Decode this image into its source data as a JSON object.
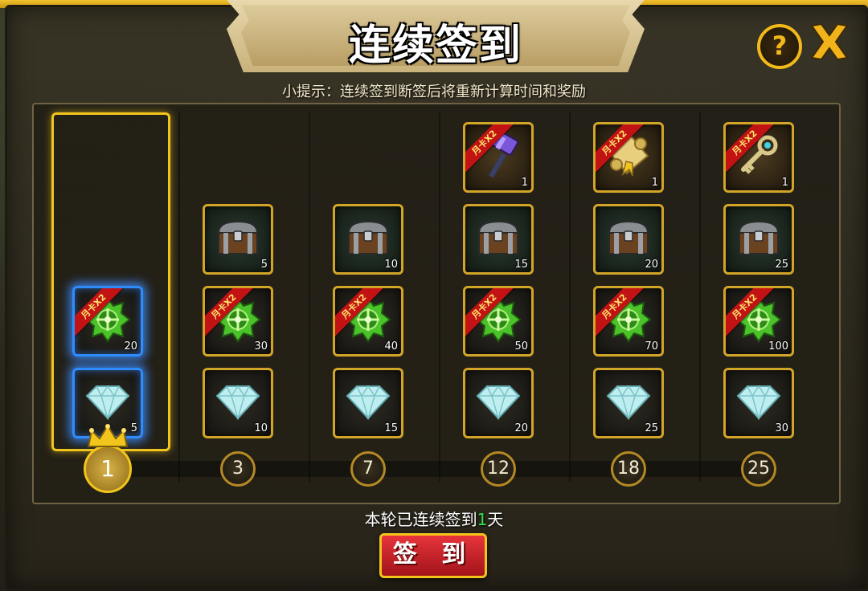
{
  "title": "连续签到",
  "tip": "小提示：连续签到断签后将重新计算时间和奖励",
  "status": {
    "prefix": "本轮已连续签到",
    "count": "1",
    "suffix": "天"
  },
  "sign_button": "签 到",
  "help_label": "?",
  "ribbon_label": "月卡X2",
  "days": [
    "1",
    "3",
    "7",
    "12",
    "18",
    "25"
  ],
  "current_day_index": 0,
  "rewards": [
    {
      "diamond": "5",
      "emblem": "20"
    },
    {
      "diamond": "10",
      "emblem": "30",
      "chest": "5"
    },
    {
      "diamond": "15",
      "emblem": "40",
      "chest": "10"
    },
    {
      "diamond": "20",
      "emblem": "50",
      "chest": "15",
      "special": "1",
      "special_icon": "hammer-icon"
    },
    {
      "diamond": "25",
      "emblem": "70",
      "chest": "20",
      "special": "1",
      "special_icon": "scroll-icon"
    },
    {
      "diamond": "30",
      "emblem": "100",
      "chest": "25",
      "special": "1",
      "special_icon": "key-icon"
    }
  ],
  "colors": {
    "gold": "#f2c51c",
    "ribbon": "#c21214",
    "active_glow": "#2f8cff",
    "button_red": "#d42a30",
    "count_green": "#33e04a"
  }
}
